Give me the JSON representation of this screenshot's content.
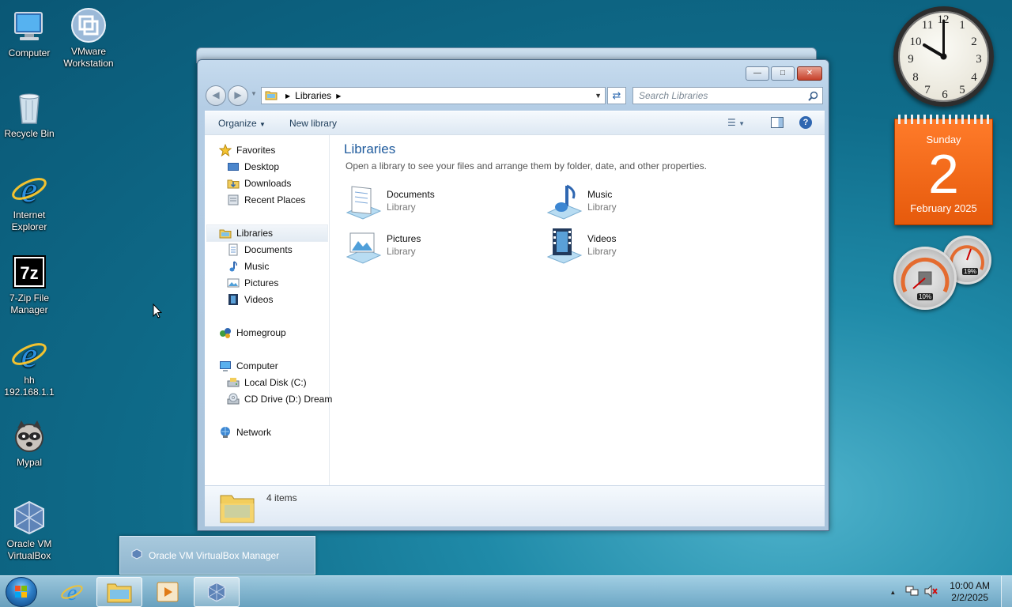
{
  "desktop": {
    "icons": [
      {
        "label": "Computer"
      },
      {
        "label": "VMware Workstation"
      },
      {
        "label": "Recycle Bin"
      },
      {
        "label": "Internet Explorer"
      },
      {
        "label": "7-Zip File Manager"
      },
      {
        "label": "hh 192.168.1.1"
      },
      {
        "label": "Mypal"
      },
      {
        "label": "Oracle VM VirtualBox"
      }
    ]
  },
  "gadgets": {
    "clock": {
      "numbers": [
        "12",
        "1",
        "2",
        "3",
        "4",
        "5",
        "6",
        "7",
        "8",
        "9",
        "10",
        "11"
      ],
      "time": "10:00"
    },
    "calendar": {
      "day": "Sunday",
      "date": "2",
      "month_year": "February 2025"
    },
    "meter": {
      "cpu": "10%",
      "memory": "19%"
    }
  },
  "window": {
    "address": {
      "crumb": "Libraries"
    },
    "search": {
      "placeholder": "Search Libraries"
    },
    "toolbar": {
      "organize": "Organize",
      "new_library": "New library"
    },
    "nav": {
      "favorites": "Favorites",
      "desktop": "Desktop",
      "downloads": "Downloads",
      "recent": "Recent Places",
      "libraries": "Libraries",
      "documents": "Documents",
      "music": "Music",
      "pictures": "Pictures",
      "videos": "Videos",
      "homegroup": "Homegroup",
      "computer": "Computer",
      "local_disk": "Local Disk (C:)",
      "cd_drive": "CD Drive (D:) Dream",
      "network": "Network"
    },
    "content": {
      "title": "Libraries",
      "subtitle": "Open a library to see your files and arrange them by folder, date, and other properties.",
      "libraries": [
        {
          "name": "Documents",
          "type": "Library"
        },
        {
          "name": "Music",
          "type": "Library"
        },
        {
          "name": "Pictures",
          "type": "Library"
        },
        {
          "name": "Videos",
          "type": "Library"
        }
      ]
    },
    "status": {
      "count": "4 items"
    }
  },
  "taskbar": {
    "preview_label": "Oracle VM VirtualBox Manager",
    "time": "10:00 AM",
    "date": "2/2/2025"
  },
  "colors": {
    "accent_title": "#1e5a9c",
    "calendar": "#f26a16"
  }
}
